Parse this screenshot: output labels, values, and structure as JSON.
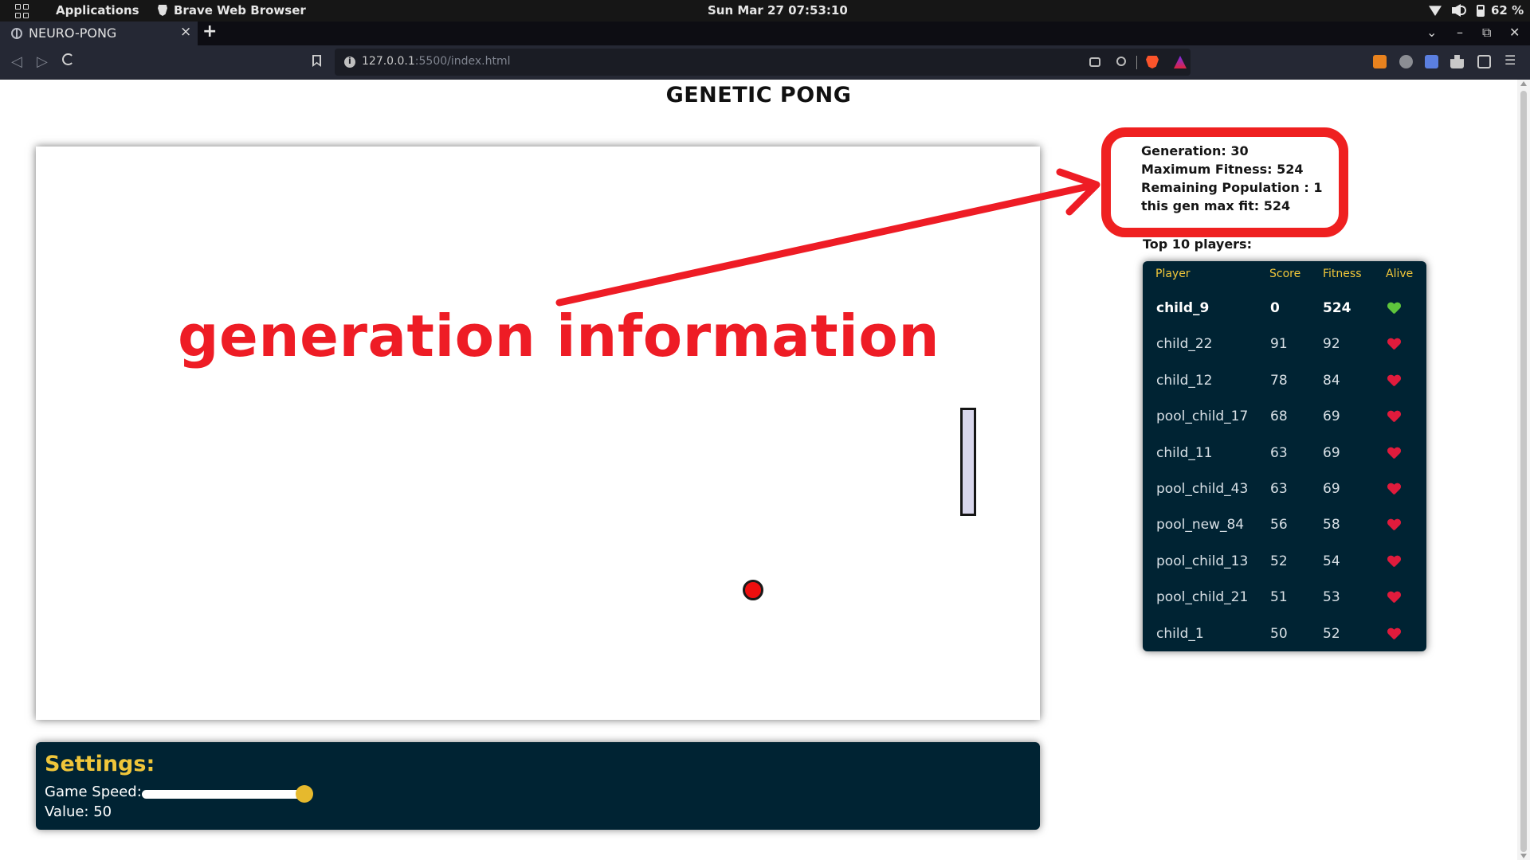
{
  "system_bar": {
    "apps_label": "Applications",
    "browser_label": "Brave Web Browser",
    "clock": "Sun Mar 27  07:53:10",
    "battery": "62 %"
  },
  "browser": {
    "tab_title": "NEURO-PONG",
    "tab_close": "×",
    "new_tab": "+",
    "url_host": "127.0.0.1",
    "url_rest": ":5500/index.html"
  },
  "page": {
    "title": "GENETIC PONG",
    "generation_info": {
      "generation": "Generation: 30",
      "max_fitness": "Maximum Fitness: 524",
      "remaining_population": "Remaining Population : 1",
      "gen_max_fit": "this gen max fit: 524"
    },
    "top10_label": "Top 10 players:",
    "leaderboard": {
      "headers": {
        "player": "Player",
        "score": "Score",
        "fitness": "Fitness",
        "alive": "Alive"
      },
      "rows": [
        {
          "player": "child_9",
          "score": "0",
          "fitness": "524",
          "alive": true
        },
        {
          "player": "child_22",
          "score": "91",
          "fitness": "92",
          "alive": false
        },
        {
          "player": "child_12",
          "score": "78",
          "fitness": "84",
          "alive": false
        },
        {
          "player": "pool_child_17",
          "score": "68",
          "fitness": "69",
          "alive": false
        },
        {
          "player": "child_11",
          "score": "63",
          "fitness": "69",
          "alive": false
        },
        {
          "player": "pool_child_43",
          "score": "63",
          "fitness": "69",
          "alive": false
        },
        {
          "player": "pool_new_84",
          "score": "56",
          "fitness": "58",
          "alive": false
        },
        {
          "player": "pool_child_13",
          "score": "52",
          "fitness": "54",
          "alive": false
        },
        {
          "player": "pool_child_21",
          "score": "51",
          "fitness": "53",
          "alive": false
        },
        {
          "player": "child_1",
          "score": "50",
          "fitness": "52",
          "alive": false
        }
      ]
    },
    "settings": {
      "title": "Settings:",
      "game_speed_label": "Game Speed:",
      "value_label": "Value: 50",
      "game_speed_value": 50
    },
    "annotation": "generation information"
  },
  "colors": {
    "panel_bg": "#002333",
    "accent_yellow": "#f0c63a",
    "annotation_red": "#ee1c25",
    "ball_red": "#ee0f0f"
  },
  "icons": {
    "alive": "green-heart-icon",
    "dead": "red-heart-icon"
  }
}
